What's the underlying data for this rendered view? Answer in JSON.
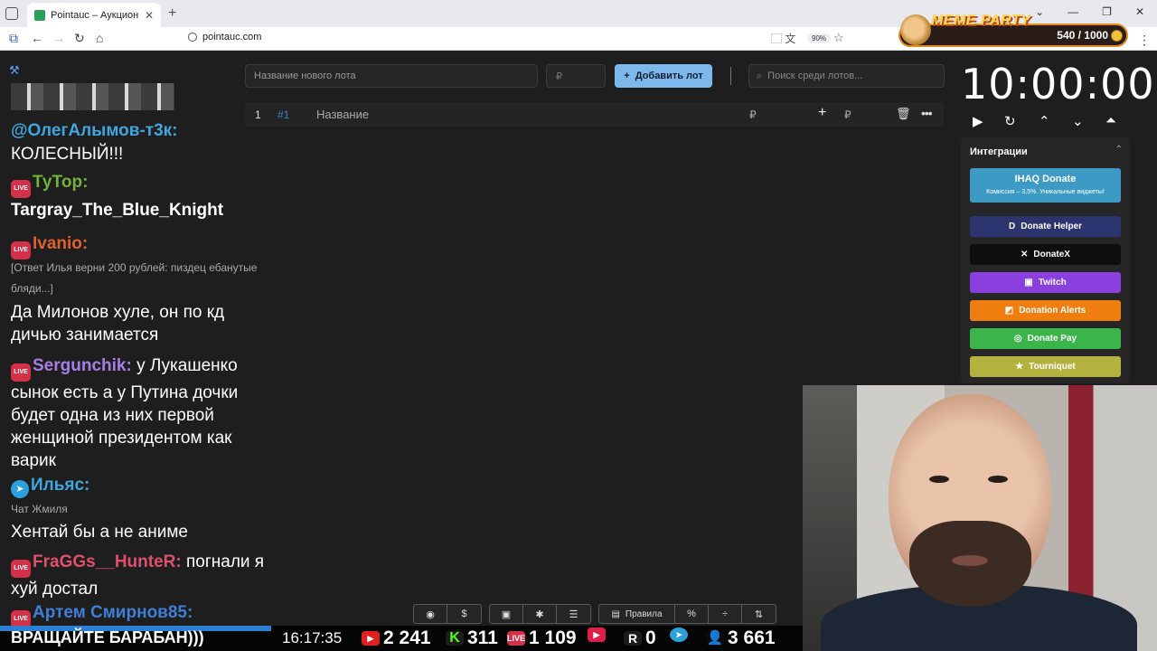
{
  "browser": {
    "tab_title": "Pointauc – Аукционы, лотерея",
    "url": "pointauc.com",
    "zoom": "90%"
  },
  "overlay": {
    "meme_logo": "MEME PARTY",
    "meme_count": "540 / 1000"
  },
  "auction": {
    "lot_name_placeholder": "Название нового лота",
    "price_placeholder": "₽",
    "add_lot_label": "Добавить лот",
    "search_placeholder": "Поиск среди лотов...",
    "lot": {
      "index": "1",
      "id": "#1",
      "name": "Название",
      "currency": "₽",
      "currency2": "₽"
    }
  },
  "timer": {
    "value": "10:00:00"
  },
  "integrations": {
    "title": "Интеграции",
    "ihaq_title": "IHAQ Donate",
    "ihaq_sub": "Комиссия – 3,5%. Уникальные виджеты!",
    "items": [
      {
        "label": "Donate Helper",
        "color": "#2c3470"
      },
      {
        "label": "DonateX",
        "color": "#0e0e0e"
      },
      {
        "label": "Twitch",
        "color": "#8a3fdf"
      },
      {
        "label": "Donation Alerts",
        "color": "#ef7d10"
      },
      {
        "label": "Donate Pay",
        "color": "#3bb54a"
      },
      {
        "label": "Tourniquet",
        "color": "#b3b23e"
      }
    ]
  },
  "chat": {
    "msgs": [
      {
        "nick": "@ОлегАлымов-т3к:",
        "text": "КОЛЕСНЫЙ!!!"
      },
      {
        "nick": "ТуТор:",
        "text": "Targray_The_Blue_Knight"
      },
      {
        "nick": "Ivanio:",
        "reply": "[Ответ Илья верни 200 рублей: пиздец ебанутые бляди...]",
        "text": "Да Милонов хуле, он по кд дичью занимается"
      },
      {
        "nick": "Sergunchik:",
        "text": "у Лукашенко сынок есть а у Путина дочки будет одна из них первой женщиной президентом как варик"
      },
      {
        "nick": "Ильяс:",
        "reply": "Чат Жмиля",
        "text": "Хентай бы а не аниме"
      },
      {
        "nick": "FraGGs__HunteR:",
        "text": "погнали я хуй достал"
      },
      {
        "nick": "Артем Смирнов85:",
        "text": "ВРАЩАЙТЕ БАРАБАН)))"
      }
    ],
    "live_badge": "LIVE"
  },
  "toolbar": {
    "rules_label": "Правила"
  },
  "stats": {
    "clock": "16:17:35",
    "youtube": "2 241",
    "kick": "311",
    "vk": "1 109",
    "rutube": "0",
    "telegram": "3 661"
  }
}
